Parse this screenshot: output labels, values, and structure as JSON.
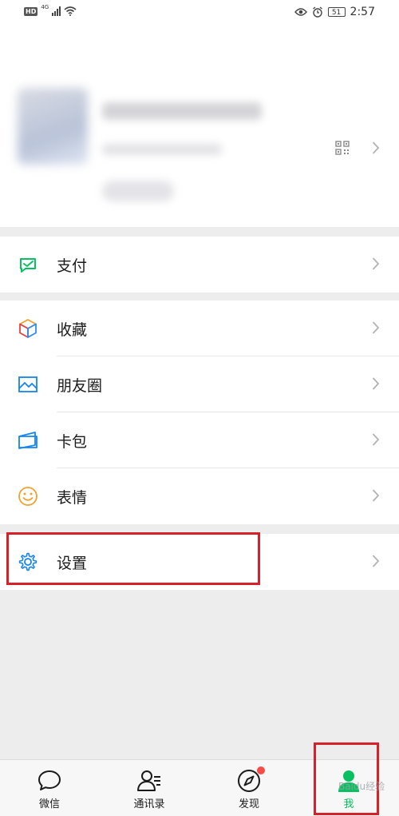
{
  "status_bar": {
    "hd": "HD",
    "network": "4G",
    "battery": "51",
    "time": "2:57"
  },
  "groups": [
    {
      "items": [
        {
          "label": "支付",
          "icon": "wallet-icon"
        }
      ]
    },
    {
      "items": [
        {
          "label": "收藏",
          "icon": "favorites-cube-icon"
        },
        {
          "label": "朋友圈",
          "icon": "moments-image-icon"
        },
        {
          "label": "卡包",
          "icon": "card-wallet-icon"
        },
        {
          "label": "表情",
          "icon": "sticker-smile-icon"
        }
      ]
    },
    {
      "items": [
        {
          "label": "设置",
          "icon": "gear-icon"
        }
      ]
    }
  ],
  "tabbar": [
    {
      "label": "微信",
      "icon": "chat-bubble-icon",
      "active": false
    },
    {
      "label": "通讯录",
      "icon": "contacts-icon",
      "active": false
    },
    {
      "label": "发现",
      "icon": "compass-icon",
      "active": false
    },
    {
      "label": "我",
      "icon": "me-person-icon",
      "active": true
    }
  ],
  "watermark": "Baidu经验",
  "colors": {
    "accent": "#07c160",
    "highlight": "#d6202a",
    "badge": "#f54c48",
    "background": "#ededed"
  }
}
